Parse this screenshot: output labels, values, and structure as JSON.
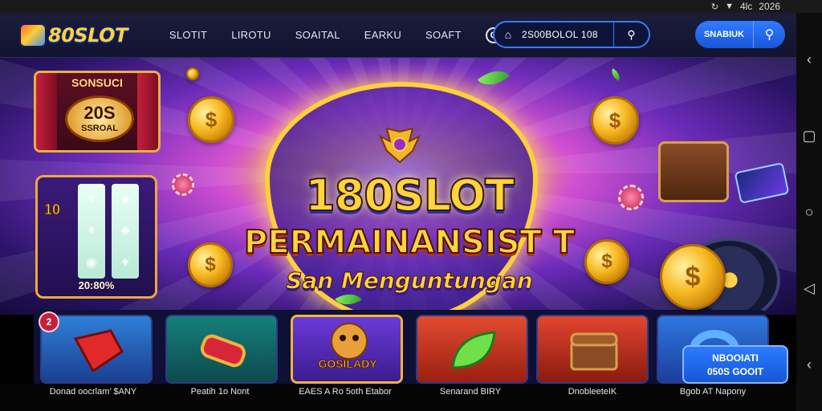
{
  "status_bar": {
    "time": "2026",
    "indicator": "4lc",
    "icons": [
      "sync-icon",
      "wifi-icon",
      "signal-icon"
    ]
  },
  "header": {
    "logo_text": "80SLOT",
    "menu": [
      {
        "label": "SLOTIT"
      },
      {
        "label": "LIROTU"
      },
      {
        "label": "SOAITAL"
      },
      {
        "label": "EARKU"
      },
      {
        "label": "SOAFT"
      }
    ],
    "help_label": "Q",
    "search_value": "2S00BOLOL 108",
    "login_label": "SNABIUK",
    "colors": {
      "accent": "#2f7dff",
      "brand": "#ffd23d"
    }
  },
  "hero": {
    "title_line1": "180SLOT",
    "title_line2": "PERMAINANSIST T",
    "title_line3": "San Menguntungan",
    "promo_top": "SONSUCI",
    "promo_big": "20S",
    "promo_small": "SSROAL",
    "slot_number": "10",
    "slot_percent": "20:80%"
  },
  "games": [
    {
      "caption": "Donad oocrlam’ $ANY"
    },
    {
      "caption": "Peatih 1o Nont"
    },
    {
      "caption": "EAES A Ro 5oth Etabor",
      "brand": "GOSILADY"
    },
    {
      "caption": "Senarand BIRY"
    },
    {
      "caption": "DnobleeteIK"
    },
    {
      "caption": "Bgob AT Napony"
    }
  ],
  "badge_number": "2",
  "register": {
    "line1": "NBOOIATI",
    "line2": "050S GOOIT"
  },
  "nav_icons": [
    "back-icon",
    "square-icon",
    "circle-icon",
    "triangle-back-icon",
    "chevron-back-icon"
  ]
}
